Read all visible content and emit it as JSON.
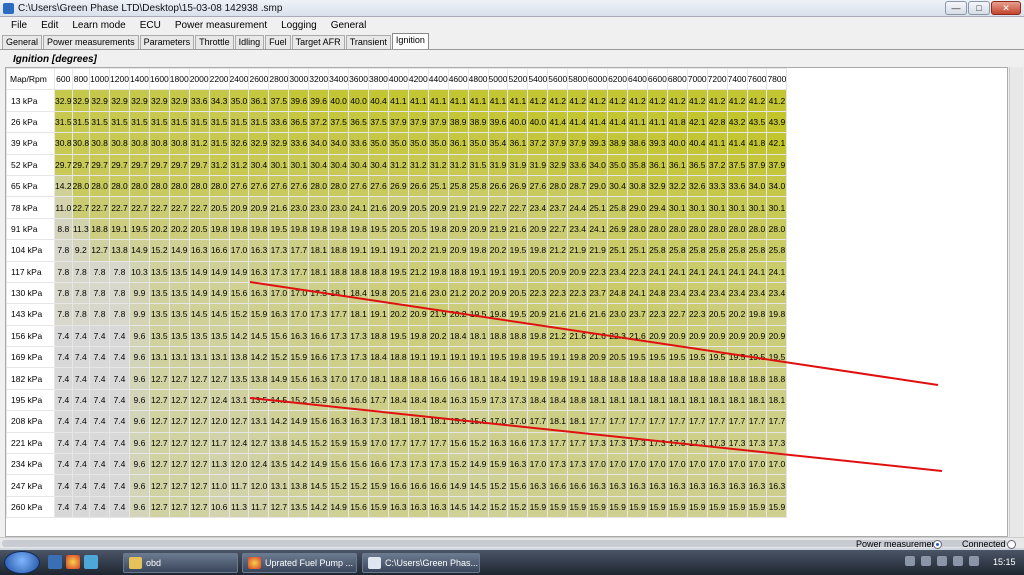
{
  "window": {
    "title": "C:\\Users\\Green Phase LTD\\Desktop\\15-03-08 142938 .smp",
    "min_glyph": "—",
    "max_glyph": "□",
    "close_glyph": "✕"
  },
  "menu": [
    "File",
    "Edit",
    "Learn mode",
    "ECU",
    "Power measurement",
    "Logging",
    "General"
  ],
  "tabs": [
    "General",
    "Power measurements",
    "Parameters",
    "Throttle",
    "Idling",
    "Fuel",
    "Target AFR",
    "Transient",
    "Ignition"
  ],
  "active_tab": "Ignition",
  "map": {
    "title": "Ignition [degrees]",
    "corner": "Map/Rpm",
    "rpm": [
      "600",
      "800",
      "1000",
      "1200",
      "1400",
      "1600",
      "1800",
      "2000",
      "2200",
      "2400",
      "2600",
      "2800",
      "3000",
      "3200",
      "3400",
      "3600",
      "3800",
      "4000",
      "4200",
      "4400",
      "4600",
      "4800",
      "5000",
      "5200",
      "5400",
      "5600",
      "5800",
      "6000",
      "6200",
      "6400",
      "6600",
      "6800",
      "7000",
      "7200",
      "7400",
      "7600",
      "7800"
    ],
    "rows": [
      {
        "label": "13 kPa",
        "values": [
          "32.9",
          "32.9",
          "32.9",
          "32.9",
          "32.9",
          "32.9",
          "32.9",
          "33.6",
          "34.3",
          "35.0",
          "36.1",
          "37.5",
          "39.6",
          "39.6",
          "40.0",
          "40.0",
          "40.4",
          "41.1",
          "41.1",
          "41.1",
          "41.1",
          "41.1",
          "41.1",
          "41.1",
          "41.2",
          "41.2",
          "41.2",
          "41.2",
          "41.2",
          "41.2",
          "41.2",
          "41.2",
          "41.2",
          "41.2",
          "41.2",
          "41.2",
          "41.2"
        ]
      },
      {
        "label": "26 kPa",
        "values": [
          "31.5",
          "31.5",
          "31.5",
          "31.5",
          "31.5",
          "31.5",
          "31.5",
          "31.5",
          "31.5",
          "31.5",
          "31.5",
          "33.6",
          "36.5",
          "37.2",
          "37.5",
          "36.5",
          "37.5",
          "37.9",
          "37.9",
          "37.9",
          "38.9",
          "38.9",
          "39.6",
          "40.0",
          "40.0",
          "41.4",
          "41.4",
          "41.4",
          "41.4",
          "41.1",
          "41.1",
          "41.8",
          "42.1",
          "42.8",
          "43.2",
          "43.5",
          "43.9"
        ]
      },
      {
        "label": "39 kPa",
        "values": [
          "30.8",
          "30.8",
          "30.8",
          "30.8",
          "30.8",
          "30.8",
          "30.8",
          "31.2",
          "31.5",
          "32.6",
          "32.9",
          "32.9",
          "33.6",
          "34.0",
          "34.0",
          "33.6",
          "35.0",
          "35.0",
          "35.0",
          "35.0",
          "36.1",
          "35.0",
          "35.4",
          "36.1",
          "37.2",
          "37.9",
          "37.9",
          "39.3",
          "38.9",
          "38.6",
          "39.3",
          "40.0",
          "40.4",
          "41.1",
          "41.4",
          "41.8",
          "42.1"
        ]
      },
      {
        "label": "52 kPa",
        "values": [
          "29.7",
          "29.7",
          "29.7",
          "29.7",
          "29.7",
          "29.7",
          "29.7",
          "29.7",
          "31.2",
          "31.2",
          "30.4",
          "30.1",
          "30.1",
          "30.4",
          "30.4",
          "30.4",
          "30.4",
          "31.2",
          "31.2",
          "31.2",
          "31.2",
          "31.5",
          "31.9",
          "31.9",
          "31.9",
          "32.9",
          "33.6",
          "34.0",
          "35.0",
          "35.8",
          "36.1",
          "36.1",
          "36.5",
          "37.2",
          "37.5",
          "37.9",
          "37.9"
        ]
      },
      {
        "label": "65 kPa",
        "values": [
          "14.2",
          "28.0",
          "28.0",
          "28.0",
          "28.0",
          "28.0",
          "28.0",
          "28.0",
          "28.0",
          "27.6",
          "27.6",
          "27.6",
          "27.6",
          "28.0",
          "28.0",
          "27.6",
          "27.6",
          "26.9",
          "26.6",
          "25.1",
          "25.8",
          "25.8",
          "26.6",
          "26.9",
          "27.6",
          "28.0",
          "28.7",
          "29.0",
          "30.4",
          "30.8",
          "32.9",
          "32.2",
          "32.6",
          "33.3",
          "33.6",
          "34.0",
          "34.0"
        ]
      },
      {
        "label": "78 kPa",
        "values": [
          "11.0",
          "22.7",
          "22.7",
          "22.7",
          "22.7",
          "22.7",
          "22.7",
          "22.7",
          "20.5",
          "20.9",
          "20.9",
          "21.6",
          "23.0",
          "23.0",
          "23.0",
          "24.1",
          "21.6",
          "20.9",
          "20.5",
          "20.9",
          "21.9",
          "21.9",
          "22.7",
          "22.7",
          "23.4",
          "23.7",
          "24.4",
          "25.1",
          "25.8",
          "29.0",
          "29.4",
          "30.1",
          "30.1",
          "30.1",
          "30.1",
          "30.1",
          "30.1"
        ]
      },
      {
        "label": "91 kPa",
        "values": [
          "8.8",
          "11.3",
          "18.8",
          "19.1",
          "19.5",
          "20.2",
          "20.2",
          "20.5",
          "19.8",
          "19.8",
          "19.8",
          "19.5",
          "19.8",
          "19.8",
          "19.8",
          "19.8",
          "19.5",
          "20.5",
          "20.5",
          "19.8",
          "20.9",
          "20.9",
          "21.9",
          "21.6",
          "20.9",
          "22.7",
          "23.4",
          "24.1",
          "26.9",
          "28.0",
          "28.0",
          "28.0",
          "28.0",
          "28.0",
          "28.0",
          "28.0",
          "28.0"
        ]
      },
      {
        "label": "104 kPa",
        "values": [
          "7.8",
          "9.2",
          "12.7",
          "13.8",
          "14.9",
          "15.2",
          "14.9",
          "16.3",
          "16.6",
          "17.0",
          "16.3",
          "17.3",
          "17.7",
          "18.1",
          "18.8",
          "19.1",
          "19.1",
          "19.1",
          "20.2",
          "21.9",
          "20.9",
          "19.8",
          "20.2",
          "19.5",
          "19.8",
          "21.2",
          "21.9",
          "21.9",
          "25.1",
          "25.1",
          "25.8",
          "25.8",
          "25.8",
          "25.8",
          "25.8",
          "25.8",
          "25.8"
        ]
      },
      {
        "label": "117 kPa",
        "values": [
          "7.8",
          "7.8",
          "7.8",
          "7.8",
          "10.3",
          "13.5",
          "13.5",
          "14.9",
          "14.9",
          "14.9",
          "16.3",
          "17.3",
          "17.7",
          "18.1",
          "18.8",
          "18.8",
          "18.8",
          "19.5",
          "21.2",
          "19.8",
          "18.8",
          "19.1",
          "19.1",
          "19.1",
          "20.5",
          "20.9",
          "20.9",
          "22.3",
          "23.4",
          "22.3",
          "24.1",
          "24.1",
          "24.1",
          "24.1",
          "24.1",
          "24.1",
          "24.1"
        ]
      },
      {
        "label": "130 kPa",
        "values": [
          "7.8",
          "7.8",
          "7.8",
          "7.8",
          "9.9",
          "13.5",
          "13.5",
          "14.9",
          "14.9",
          "15.6",
          "16.3",
          "17.0",
          "17.0",
          "17.3",
          "18.1",
          "18.4",
          "19.8",
          "20.5",
          "21.6",
          "23.0",
          "21.2",
          "20.2",
          "20.9",
          "20.5",
          "22.3",
          "22.3",
          "22.3",
          "23.7",
          "24.8",
          "24.1",
          "24.8",
          "23.4",
          "23.4",
          "23.4",
          "23.4",
          "23.4",
          "23.4"
        ]
      },
      {
        "label": "143 kPa",
        "values": [
          "7.8",
          "7.8",
          "7.8",
          "7.8",
          "9.9",
          "13.5",
          "13.5",
          "14.5",
          "14.5",
          "15.2",
          "15.9",
          "16.3",
          "17.0",
          "17.3",
          "17.7",
          "18.1",
          "19.1",
          "20.2",
          "20.9",
          "21.9",
          "20.2",
          "19.5",
          "19.8",
          "19.5",
          "20.9",
          "21.6",
          "21.6",
          "21.6",
          "23.0",
          "23.7",
          "22.3",
          "22.7",
          "22.3",
          "20.5",
          "20.2",
          "19.8",
          "19.8"
        ]
      },
      {
        "label": "156 kPa",
        "values": [
          "7.4",
          "7.4",
          "7.4",
          "7.4",
          "9.6",
          "13.5",
          "13.5",
          "13.5",
          "13.5",
          "14.2",
          "14.5",
          "15.6",
          "16.3",
          "16.6",
          "17.3",
          "17.3",
          "18.8",
          "19.5",
          "19.8",
          "20.2",
          "18.4",
          "18.1",
          "18.8",
          "18.8",
          "19.8",
          "21.2",
          "21.6",
          "21.6",
          "22.3",
          "21.6",
          "20.9",
          "20.9",
          "20.9",
          "20.9",
          "20.9",
          "20.9",
          "20.9"
        ]
      },
      {
        "label": "169 kPa",
        "values": [
          "7.4",
          "7.4",
          "7.4",
          "7.4",
          "9.6",
          "13.1",
          "13.1",
          "13.1",
          "13.1",
          "13.8",
          "14.2",
          "15.2",
          "15.9",
          "16.6",
          "17.3",
          "17.3",
          "18.4",
          "18.8",
          "19.1",
          "19.1",
          "19.1",
          "19.1",
          "19.5",
          "19.8",
          "19.5",
          "19.1",
          "19.8",
          "20.9",
          "20.5",
          "19.5",
          "19.5",
          "19.5",
          "19.5",
          "19.5",
          "19.5",
          "19.5",
          "19.5"
        ]
      },
      {
        "label": "182 kPa",
        "values": [
          "7.4",
          "7.4",
          "7.4",
          "7.4",
          "9.6",
          "12.7",
          "12.7",
          "12.7",
          "12.7",
          "13.5",
          "13.8",
          "14.9",
          "15.6",
          "16.3",
          "17.0",
          "17.0",
          "18.1",
          "18.8",
          "18.8",
          "16.6",
          "16.6",
          "18.1",
          "18.4",
          "19.1",
          "19.8",
          "19.8",
          "19.1",
          "18.8",
          "18.8",
          "18.8",
          "18.8",
          "18.8",
          "18.8",
          "18.8",
          "18.8",
          "18.8",
          "18.8"
        ]
      },
      {
        "label": "195 kPa",
        "values": [
          "7.4",
          "7.4",
          "7.4",
          "7.4",
          "9.6",
          "12.7",
          "12.7",
          "12.7",
          "12.4",
          "13.1",
          "13.5",
          "14.5",
          "15.2",
          "15.9",
          "16.6",
          "16.6",
          "17.7",
          "18.4",
          "18.4",
          "18.4",
          "16.3",
          "15.9",
          "17.3",
          "17.3",
          "18.4",
          "18.4",
          "18.8",
          "18.1",
          "18.1",
          "18.1",
          "18.1",
          "18.1",
          "18.1",
          "18.1",
          "18.1",
          "18.1",
          "18.1"
        ]
      },
      {
        "label": "208 kPa",
        "values": [
          "7.4",
          "7.4",
          "7.4",
          "7.4",
          "9.6",
          "12.7",
          "12.7",
          "12.7",
          "12.0",
          "12.7",
          "13.1",
          "14.2",
          "14.9",
          "15.6",
          "16.3",
          "16.3",
          "17.3",
          "18.1",
          "18.1",
          "18.1",
          "15.9",
          "15.6",
          "17.0",
          "17.0",
          "17.7",
          "18.1",
          "18.1",
          "17.7",
          "17.7",
          "17.7",
          "17.7",
          "17.7",
          "17.7",
          "17.7",
          "17.7",
          "17.7",
          "17.7"
        ]
      },
      {
        "label": "221 kPa",
        "values": [
          "7.4",
          "7.4",
          "7.4",
          "7.4",
          "9.6",
          "12.7",
          "12.7",
          "12.7",
          "11.7",
          "12.4",
          "12.7",
          "13.8",
          "14.5",
          "15.2",
          "15.9",
          "15.9",
          "17.0",
          "17.7",
          "17.7",
          "17.7",
          "15.6",
          "15.2",
          "16.3",
          "16.6",
          "17.3",
          "17.7",
          "17.7",
          "17.3",
          "17.3",
          "17.3",
          "17.3",
          "17.3",
          "17.3",
          "17.3",
          "17.3",
          "17.3",
          "17.3"
        ]
      },
      {
        "label": "234 kPa",
        "values": [
          "7.4",
          "7.4",
          "7.4",
          "7.4",
          "9.6",
          "12.7",
          "12.7",
          "12.7",
          "11.3",
          "12.0",
          "12.4",
          "13.5",
          "14.2",
          "14.9",
          "15.6",
          "15.6",
          "16.6",
          "17.3",
          "17.3",
          "17.3",
          "15.2",
          "14.9",
          "15.9",
          "16.3",
          "17.0",
          "17.3",
          "17.3",
          "17.0",
          "17.0",
          "17.0",
          "17.0",
          "17.0",
          "17.0",
          "17.0",
          "17.0",
          "17.0",
          "17.0"
        ]
      },
      {
        "label": "247 kPa",
        "values": [
          "7.4",
          "7.4",
          "7.4",
          "7.4",
          "9.6",
          "12.7",
          "12.7",
          "12.7",
          "11.0",
          "11.7",
          "12.0",
          "13.1",
          "13.8",
          "14.5",
          "15.2",
          "15.2",
          "15.9",
          "16.6",
          "16.6",
          "16.6",
          "14.9",
          "14.5",
          "15.2",
          "15.6",
          "16.3",
          "16.6",
          "16.6",
          "16.3",
          "16.3",
          "16.3",
          "16.3",
          "16.3",
          "16.3",
          "16.3",
          "16.3",
          "16.3",
          "16.3"
        ]
      },
      {
        "label": "260 kPa",
        "values": [
          "7.4",
          "7.4",
          "7.4",
          "7.4",
          "9.6",
          "12.7",
          "12.7",
          "12.7",
          "10.6",
          "11.3",
          "11.7",
          "12.7",
          "13.5",
          "14.2",
          "14.9",
          "15.6",
          "15.9",
          "16.3",
          "16.3",
          "16.3",
          "14.5",
          "14.2",
          "15.2",
          "15.2",
          "15.9",
          "15.9",
          "15.9",
          "15.9",
          "15.9",
          "15.9",
          "15.9",
          "15.9",
          "15.9",
          "15.9",
          "15.9",
          "15.9",
          "15.9"
        ]
      }
    ]
  },
  "colors": {
    "cell_high": "#c2c42a",
    "cell_low": "#d8d8d8",
    "annotation_line": "#e01010"
  },
  "status": {
    "power_measurement": "Power measurement",
    "connected": "Connected"
  },
  "taskbar": {
    "items": [
      "obd",
      "Uprated Fuel Pump ...",
      "C:\\Users\\Green Phas..."
    ],
    "clock": "15:15"
  }
}
